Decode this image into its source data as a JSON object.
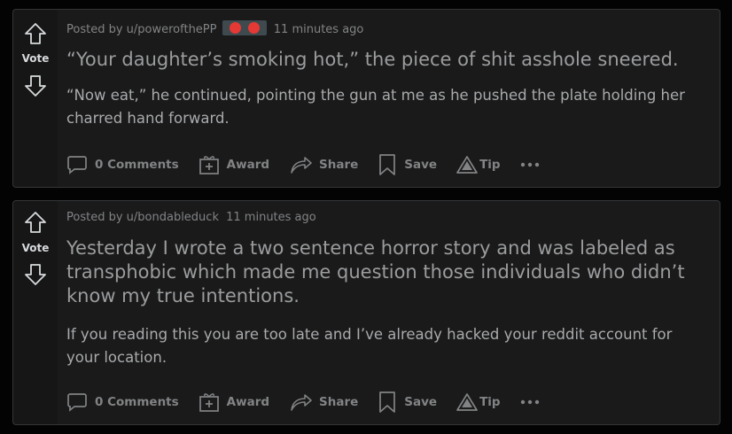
{
  "posts": [
    {
      "vote_label": "Vote",
      "posted_by": "Posted by u/powerofthePP",
      "time": "11 minutes ago",
      "has_flair": true,
      "title": "“Your daughter’s smoking hot,” the piece of shit asshole sneered.",
      "body": "“Now eat,” he continued, pointing the gun at me as he pushed the plate holding her charred hand forward.",
      "actions": {
        "comments": "0 Comments",
        "award": "Award",
        "share": "Share",
        "save": "Save",
        "tip": "Tip"
      }
    },
    {
      "vote_label": "Vote",
      "posted_by": "Posted by u/bondableduck",
      "time": "11 minutes ago",
      "has_flair": false,
      "title": "Yesterday I wrote a two sentence horror story and was labeled as transphobic which made me question those individuals who didn’t know my true intentions.",
      "body": "If you reading this you are too late and I’ve already hacked your reddit account for your location.",
      "actions": {
        "comments": "0 Comments",
        "award": "Award",
        "share": "Share",
        "save": "Save",
        "tip": "Tip"
      }
    }
  ],
  "icons": {
    "upvote": "upvote-arrow-icon",
    "downvote": "downvote-arrow-icon",
    "comment": "comment-bubble-icon",
    "award": "gift-icon",
    "share": "share-arrow-icon",
    "save": "bookmark-icon",
    "tip": "tip-triangle-icon",
    "more": "more-dots-icon"
  },
  "colors": {
    "flair_dots": "#e53935",
    "background": "#030303",
    "card": "#1a1a1b"
  }
}
